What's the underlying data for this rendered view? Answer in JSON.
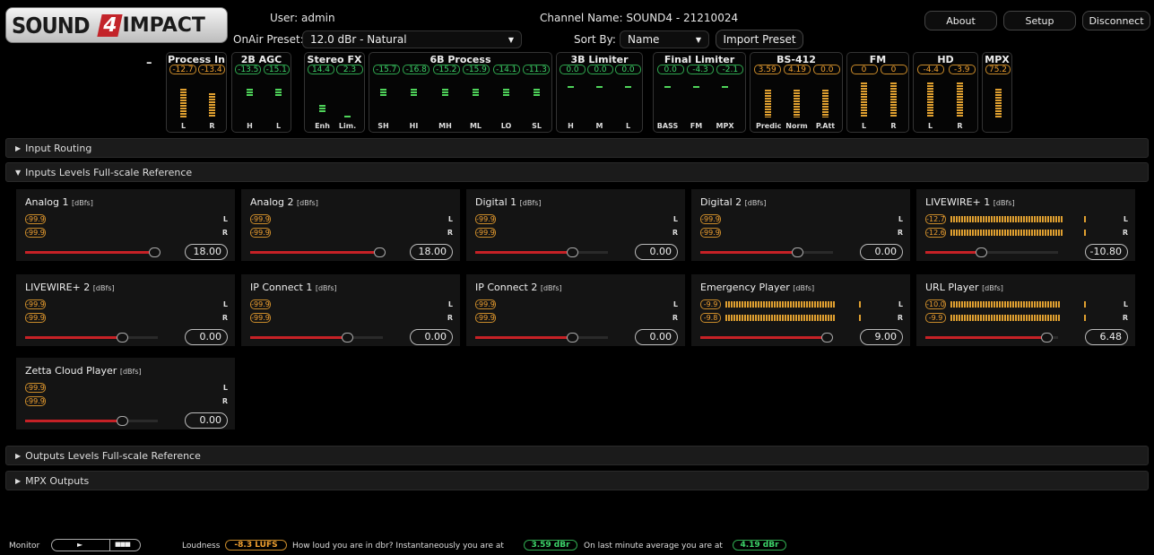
{
  "header": {
    "logo_text": "SOUND4 IMPACT",
    "user_label": "User:",
    "user_value": "admin",
    "onair_label": "OnAir Preset:",
    "onair_value": "12.0 dBr - Natural",
    "channel_label": "Channel Name:",
    "channel_value": "SOUND4 - 21210024",
    "sortby_label": "Sort By:",
    "sortby_value": "Name",
    "import_preset": "Import Preset",
    "about": "About",
    "setup": "Setup",
    "disconnect": "Disconnect"
  },
  "meters": {
    "collapse": "–",
    "groups": [
      {
        "title": "Process In",
        "values": [
          "-12.7",
          "-13.4"
        ],
        "pill_color": "orange",
        "labels": [
          "L",
          "R"
        ]
      },
      {
        "title": "2B AGC",
        "values": [
          "-13.5",
          "-15.1"
        ],
        "pill_color": "green",
        "labels": [
          "H",
          "L"
        ]
      },
      {
        "title": "Stereo FX",
        "values": [
          "14.4",
          "2.3"
        ],
        "pill_color": "green",
        "labels": [
          "Enh",
          "Lim."
        ]
      },
      {
        "title": "6B Process",
        "values": [
          "-15.7",
          "-16.8",
          "-15.2",
          "-15.9",
          "-14.1",
          "-11.3"
        ],
        "pill_color": "green",
        "labels": [
          "SH",
          "HI",
          "MH",
          "ML",
          "LO",
          "SL"
        ]
      },
      {
        "title": "3B Limiter",
        "values": [
          "0.0",
          "0.0",
          "0.0"
        ],
        "pill_color": "green",
        "labels": [
          "H",
          "M",
          "L"
        ]
      },
      {
        "title": "Final Limiter",
        "values": [
          "0.0",
          "-4.3",
          "-2.1"
        ],
        "pill_color": "green",
        "labels": [
          "BASS",
          "FM",
          "MPX"
        ]
      },
      {
        "title": "BS-412",
        "values": [
          "3.59",
          "4.19",
          "0.0"
        ],
        "pill_color": "orange",
        "labels": [
          "Predic",
          "Norm",
          "P.Att"
        ]
      },
      {
        "title": "FM",
        "values": [
          "0",
          "0"
        ],
        "pill_color": "orange",
        "labels": [
          "L",
          "R"
        ]
      },
      {
        "title": "HD",
        "values": [
          "-4.4",
          "-3.9"
        ],
        "pill_color": "orange",
        "labels": [
          "L",
          "R"
        ]
      },
      {
        "title": "MPX",
        "values": [
          "75.2"
        ],
        "pill_color": "orange",
        "labels": [
          ""
        ]
      }
    ]
  },
  "sections": {
    "input_routing": "Input Routing",
    "input_levels": "Inputs Levels Full-scale Reference",
    "output_levels": "Outputs Levels Full-scale Reference",
    "mpx_outputs": "MPX Outputs"
  },
  "unit": "[dBfs]",
  "inputs": [
    {
      "name": "Analog 1",
      "l": "-99.9",
      "r": "-99.9",
      "value": "18.00",
      "slider": 0.97,
      "l_level": 0,
      "r_level": 0
    },
    {
      "name": "Analog 2",
      "l": "-99.9",
      "r": "-99.9",
      "value": "18.00",
      "slider": 0.97,
      "l_level": 0,
      "r_level": 0
    },
    {
      "name": "Digital 1",
      "l": "-99.9",
      "r": "-99.9",
      "value": "0.00",
      "slider": 0.73,
      "l_level": 0,
      "r_level": 0
    },
    {
      "name": "Digital 2",
      "l": "-99.9",
      "r": "-99.9",
      "value": "0.00",
      "slider": 0.73,
      "l_level": 0,
      "r_level": 0
    },
    {
      "name": "LIVEWIRE+ 1",
      "l": "-12.7",
      "r": "-12.6",
      "value": "-10.80",
      "slider": 0.42,
      "l_level": 0.78,
      "r_level": 0.78
    },
    {
      "name": "LIVEWIRE+ 2",
      "l": "-99.9",
      "r": "-99.9",
      "value": "0.00",
      "slider": 0.73,
      "l_level": 0,
      "r_level": 0
    },
    {
      "name": "IP Connect 1",
      "l": "-99.9",
      "r": "-99.9",
      "value": "0.00",
      "slider": 0.73,
      "l_level": 0,
      "r_level": 0
    },
    {
      "name": "IP Connect 2",
      "l": "-99.9",
      "r": "-99.9",
      "value": "0.00",
      "slider": 0.73,
      "l_level": 0,
      "r_level": 0
    },
    {
      "name": "Emergency Player",
      "l": "-9.9",
      "r": "-9.8",
      "value": "9.00",
      "slider": 0.95,
      "l_level": 0.76,
      "r_level": 0.77
    },
    {
      "name": "URL Player",
      "l": "-10.0",
      "r": "-9.9",
      "value": "6.48",
      "slider": 0.91,
      "l_level": 0.76,
      "r_level": 0.77
    },
    {
      "name": "Zetta Cloud Player",
      "l": "-99.9",
      "r": "-99.9",
      "value": "0.00",
      "slider": 0.73,
      "l_level": 0,
      "r_level": 0
    }
  ],
  "channel_labels": {
    "l": "L",
    "r": "R"
  },
  "footer": {
    "monitor": "Monitor",
    "play": "►",
    "dots": "■■■",
    "loudness_label": "Loudness",
    "loudness_value": "-8.3 LUFS",
    "text1": "How loud you are in dbr? Instantaneously you are at",
    "inst_value": "3.59 dBr",
    "text2": "On last minute average you are at",
    "avg_value": "4.19 dBr"
  },
  "colors": {
    "accent_red": "#c62126",
    "meter_green": "#4fd45a",
    "meter_orange": "#e0a030"
  }
}
